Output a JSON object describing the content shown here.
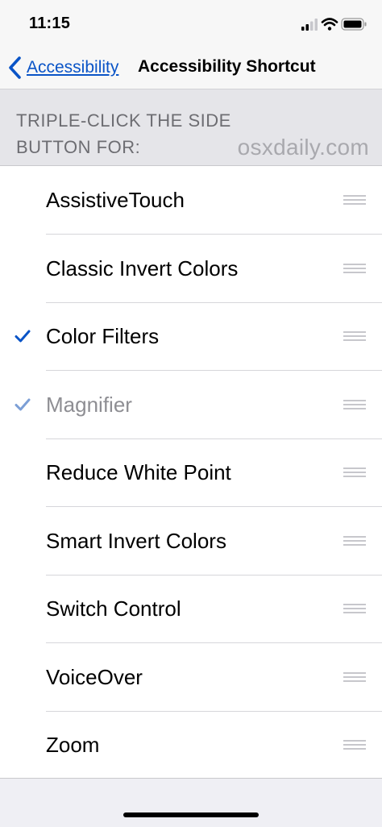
{
  "status_bar": {
    "time": "11:15",
    "icons": [
      "cellular-signal-icon",
      "wifi-icon",
      "battery-icon"
    ]
  },
  "nav": {
    "back_label": "Accessibility",
    "title": "Accessibility Shortcut",
    "accent_color": "#0a54c7"
  },
  "section": {
    "header": "TRIPLE-CLICK THE SIDE BUTTON FOR:",
    "watermark": "osxdaily.com"
  },
  "options": [
    {
      "label": "AssistiveTouch",
      "checked": false,
      "dimmed": false
    },
    {
      "label": "Classic Invert Colors",
      "checked": false,
      "dimmed": false
    },
    {
      "label": "Color Filters",
      "checked": true,
      "dimmed": false
    },
    {
      "label": "Magnifier",
      "checked": true,
      "dimmed": true
    },
    {
      "label": "Reduce White Point",
      "checked": false,
      "dimmed": false
    },
    {
      "label": "Smart Invert Colors",
      "checked": false,
      "dimmed": false
    },
    {
      "label": "Switch Control",
      "checked": false,
      "dimmed": false
    },
    {
      "label": "VoiceOver",
      "checked": false,
      "dimmed": false
    },
    {
      "label": "Zoom",
      "checked": false,
      "dimmed": false
    }
  ]
}
